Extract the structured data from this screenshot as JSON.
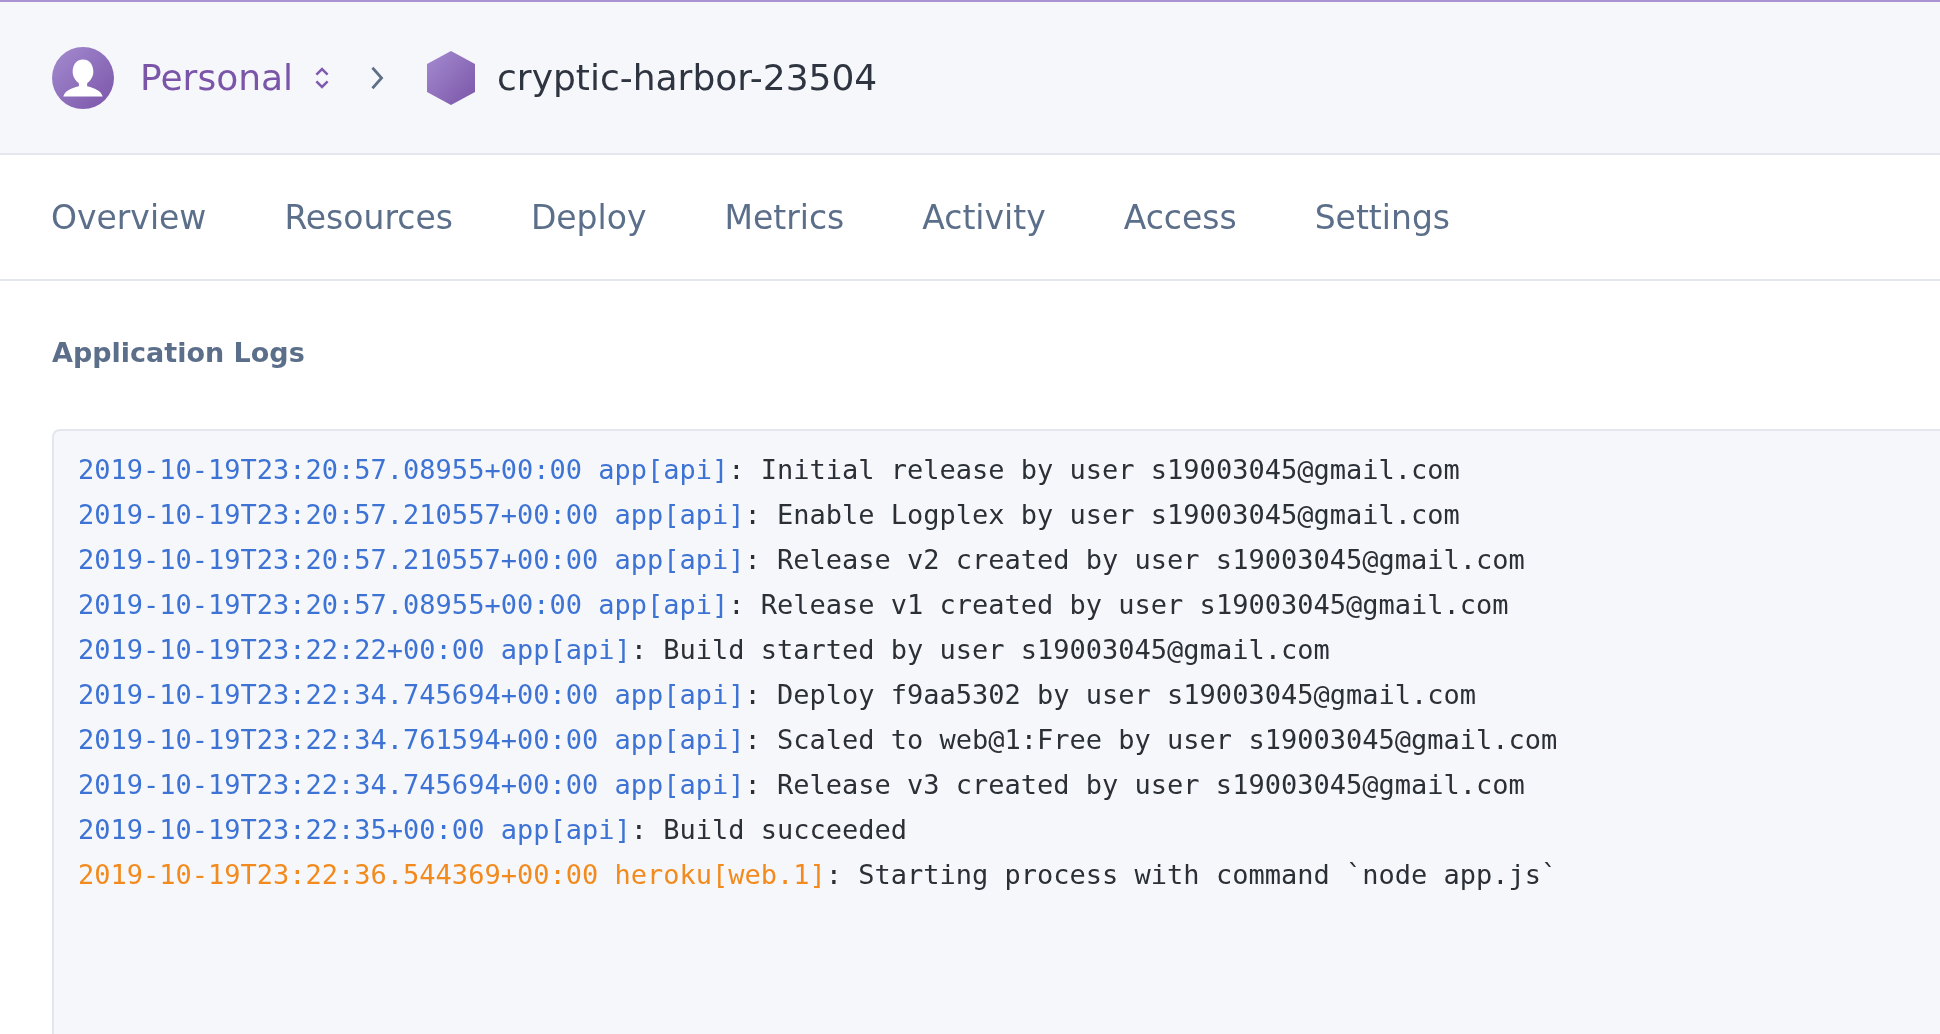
{
  "breadcrumb": {
    "account": "Personal",
    "app": "cryptic-harbor-23504"
  },
  "tabs": [
    {
      "label": "Overview"
    },
    {
      "label": "Resources"
    },
    {
      "label": "Deploy"
    },
    {
      "label": "Metrics"
    },
    {
      "label": "Activity"
    },
    {
      "label": "Access"
    },
    {
      "label": "Settings"
    }
  ],
  "section_title": "Application Logs",
  "log_lines": [
    {
      "timestamp": "2019-10-19T23:20:57.08955+00:00",
      "source": "app[api]",
      "message": ": Initial release by user s19003045@gmail.com",
      "color": "#3d73d4"
    },
    {
      "timestamp": "2019-10-19T23:20:57.210557+00:00",
      "source": "app[api]",
      "message": ": Enable Logplex by user s19003045@gmail.com",
      "color": "#3d73d4"
    },
    {
      "timestamp": "2019-10-19T23:20:57.210557+00:00",
      "source": "app[api]",
      "message": ": Release v2 created by user s19003045@gmail.com",
      "color": "#3d73d4"
    },
    {
      "timestamp": "2019-10-19T23:20:57.08955+00:00",
      "source": "app[api]",
      "message": ": Release v1 created by user s19003045@gmail.com",
      "color": "#3d73d4"
    },
    {
      "timestamp": "2019-10-19T23:22:22+00:00",
      "source": "app[api]",
      "message": ": Build started by user s19003045@gmail.com",
      "color": "#3d73d4"
    },
    {
      "timestamp": "2019-10-19T23:22:34.745694+00:00",
      "source": "app[api]",
      "message": ": Deploy f9aa5302 by user s19003045@gmail.com",
      "color": "#3d73d4"
    },
    {
      "timestamp": "2019-10-19T23:22:34.761594+00:00",
      "source": "app[api]",
      "message": ": Scaled to web@1:Free by user s19003045@gmail.com",
      "color": "#3d73d4"
    },
    {
      "timestamp": "2019-10-19T23:22:34.745694+00:00",
      "source": "app[api]",
      "message": ": Release v3 created by user s19003045@gmail.com",
      "color": "#3d73d4"
    },
    {
      "timestamp": "2019-10-19T23:22:35+00:00",
      "source": "app[api]",
      "message": ": Build succeeded",
      "color": "#3d73d4"
    },
    {
      "timestamp": "2019-10-19T23:22:36.544369+00:00",
      "source": "heroku[web.1]",
      "message": ": Starting process with command `node app.js`",
      "color": "#f28a1d"
    }
  ]
}
